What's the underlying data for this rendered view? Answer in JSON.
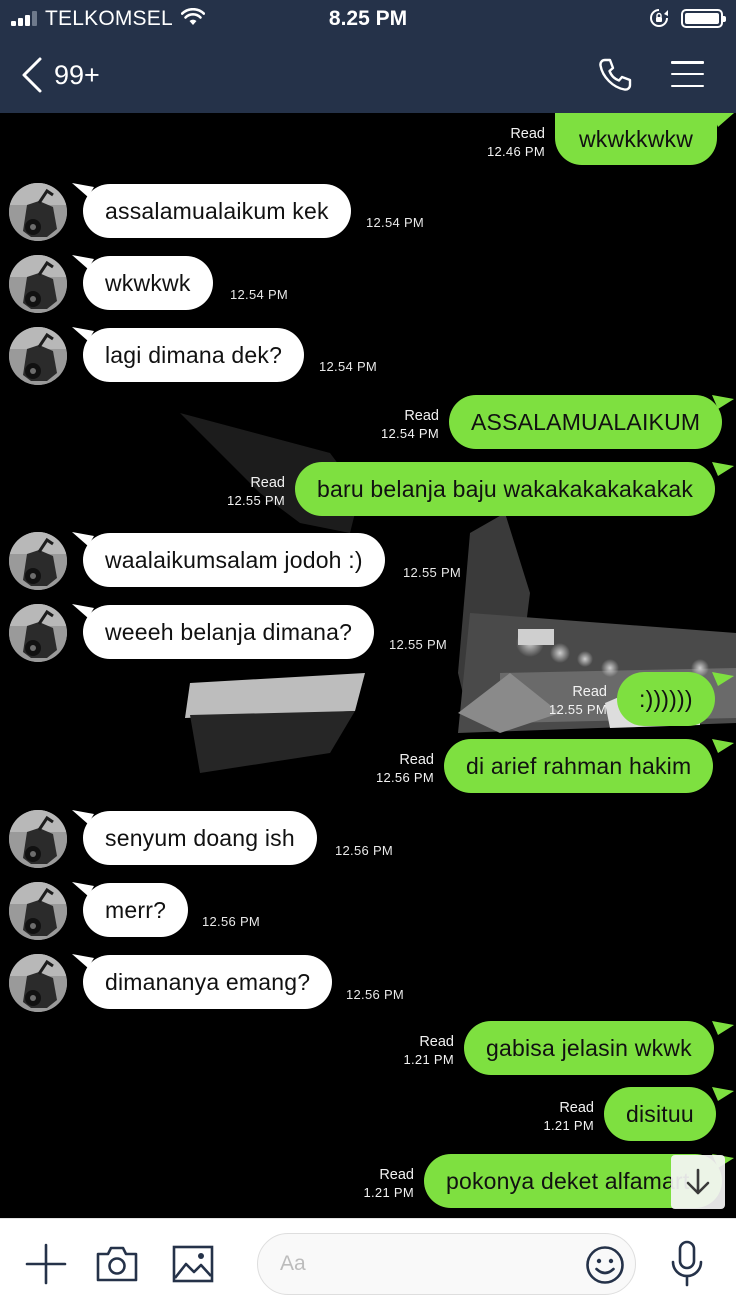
{
  "status_bar": {
    "carrier": "TELKOMSEL",
    "time": "8.25 PM"
  },
  "header": {
    "unread_count": "99+"
  },
  "messages": [
    {
      "side": "out",
      "text": "wkwkkwkw",
      "status": "Read",
      "time": "12.46 PM"
    },
    {
      "side": "in",
      "text": "assalamualaikum kek",
      "time": "12.54 PM"
    },
    {
      "side": "in",
      "text": "wkwkwk",
      "time": "12.54 PM"
    },
    {
      "side": "in",
      "text": "lagi dimana dek?",
      "time": "12.54 PM"
    },
    {
      "side": "out",
      "text": "ASSALAMUALAIKUM",
      "status": "Read",
      "time": "12.54 PM"
    },
    {
      "side": "out",
      "text": "baru belanja baju wakakakakakakak",
      "status": "Read",
      "time": "12.55 PM"
    },
    {
      "side": "in",
      "text": "waalaikumsalam jodoh :)",
      "time": "12.55 PM"
    },
    {
      "side": "in",
      "text": "weeeh belanja dimana?",
      "time": "12.55 PM"
    },
    {
      "side": "out",
      "text": ":))))))",
      "status": "Read",
      "time": "12.55 PM"
    },
    {
      "side": "out",
      "text": "di arief rahman hakim",
      "status": "Read",
      "time": "12.56 PM"
    },
    {
      "side": "in",
      "text": "senyum doang ish",
      "time": "12.56 PM"
    },
    {
      "side": "in",
      "text": "merr?",
      "time": "12.56 PM"
    },
    {
      "side": "in",
      "text": "dimananya emang?",
      "time": "12.56 PM"
    },
    {
      "side": "out",
      "text": "gabisa jelasin wkwk",
      "status": "Read",
      "time": "1.21 PM"
    },
    {
      "side": "out",
      "text": "disituu",
      "status": "Read",
      "time": "1.21 PM"
    },
    {
      "side": "out",
      "text": "pokonya deket alfamart",
      "status": "Read",
      "time": "1.21 PM"
    }
  ],
  "input": {
    "placeholder": "Aa",
    "value": ""
  },
  "icons": {
    "back": "chevron-left-icon",
    "call": "phone-icon",
    "menu": "hamburger-menu-icon",
    "scroll": "arrow-down-icon",
    "add": "plus-icon",
    "camera": "camera-icon",
    "gallery": "image-icon",
    "emoji": "smiley-icon",
    "voice": "microphone-icon"
  },
  "colors": {
    "header_bg": "#253249",
    "outgoing_bubble": "#7ee040",
    "incoming_bubble": "#ffffff",
    "chat_bg": "#000000",
    "icon_blue": "#253249"
  }
}
